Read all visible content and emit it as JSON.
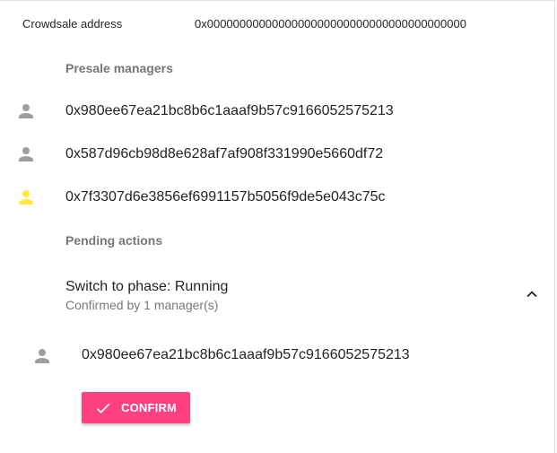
{
  "crowdsale": {
    "label": "Crowdsale address",
    "value": "0x0000000000000000000000000000000000000000"
  },
  "presale_managers": {
    "header": "Presale managers",
    "items": [
      {
        "address": "0x980ee67ea21bc8b6c1aaaf9b57c9166052575213",
        "icon": "person-icon",
        "icon_color": "#9e9e9e"
      },
      {
        "address": "0x587d96cb98d8e628af7af908f331990e5660df72",
        "icon": "person-icon",
        "icon_color": "#9e9e9e"
      },
      {
        "address": "0x7f3307d6e3856ef6991157b5056f9de5e043c75c",
        "icon": "person-icon",
        "icon_color": "#ffeb3b"
      }
    ]
  },
  "pending_actions": {
    "header": "Pending actions",
    "action": {
      "title": "Switch to phase: Running",
      "subtitle": "Confirmed by 1 manager(s)",
      "expanded": true,
      "confirmed_by": [
        {
          "address": "0x980ee67ea21bc8b6c1aaaf9b57c9166052575213",
          "icon": "person-icon",
          "icon_color": "#9e9e9e"
        }
      ],
      "confirm_label": "CONFIRM"
    }
  },
  "colors": {
    "accent": "#ff4081",
    "icon_default": "#9e9e9e",
    "icon_current_user": "#ffeb3b"
  }
}
